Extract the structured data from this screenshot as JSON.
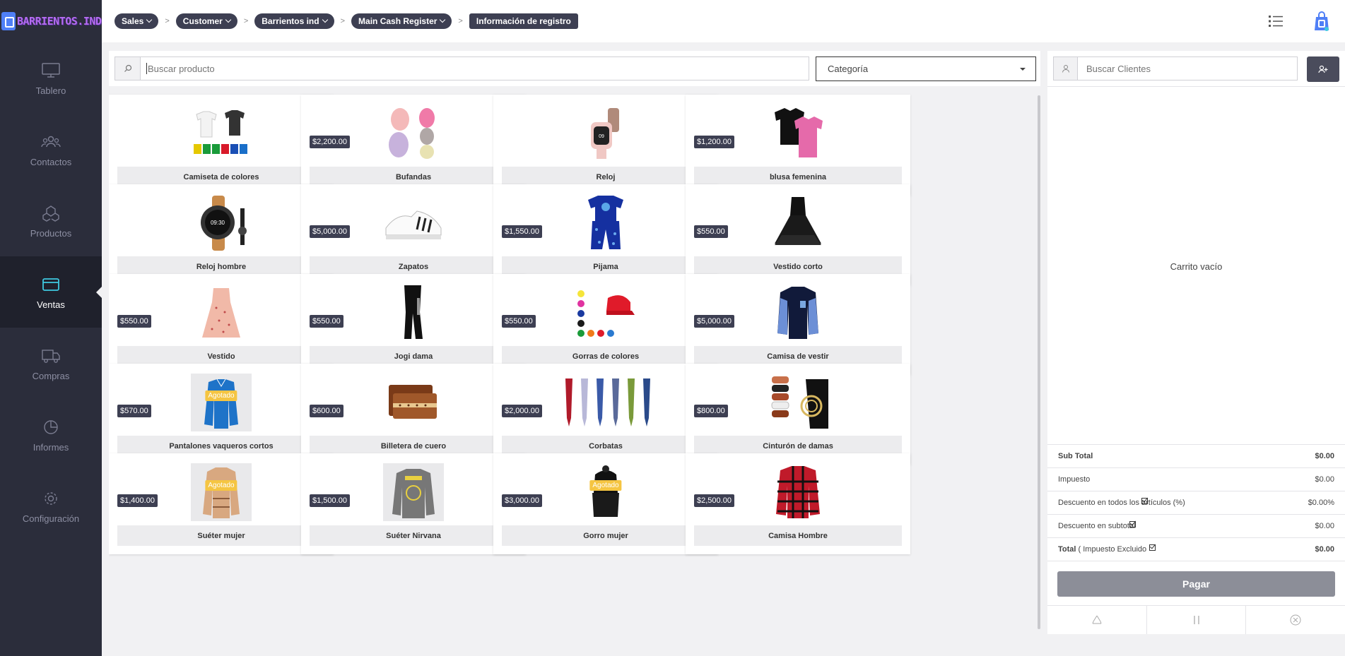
{
  "app": {
    "logo_text": "BARRIENTOS.IND"
  },
  "sidebar": {
    "items": [
      {
        "label": "Tablero",
        "icon": "monitor-icon",
        "active": false
      },
      {
        "label": "Contactos",
        "icon": "users-icon",
        "active": false
      },
      {
        "label": "Productos",
        "icon": "cubes-icon",
        "active": false
      },
      {
        "label": "Ventas",
        "icon": "card-icon",
        "active": true
      },
      {
        "label": "Compras",
        "icon": "truck-icon",
        "active": false
      },
      {
        "label": "Informes",
        "icon": "pie-chart-icon",
        "active": false
      },
      {
        "label": "Configuración",
        "icon": "gear-icon",
        "active": false
      }
    ]
  },
  "breadcrumb": {
    "items": [
      "Sales",
      "Customer",
      "Barrientos ind",
      "Main Cash Register"
    ],
    "last": "Información de registro",
    "separator": ">"
  },
  "search": {
    "placeholder": "Buscar producto"
  },
  "category": {
    "selected": "Categoría"
  },
  "products": [
    {
      "name": "Camiseta de colores",
      "price": "",
      "badge": ""
    },
    {
      "name": "Bufandas",
      "price": "$2,200.00",
      "badge": ""
    },
    {
      "name": "Reloj",
      "price": "",
      "badge": ""
    },
    {
      "name": "blusa femenina",
      "price": "$1,200.00",
      "badge": ""
    },
    {
      "name": "Reloj hombre",
      "price": "",
      "badge": ""
    },
    {
      "name": "Zapatos",
      "price": "$5,000.00",
      "badge": ""
    },
    {
      "name": "Pijama",
      "price": "$1,550.00",
      "badge": ""
    },
    {
      "name": "Vestido corto",
      "price": "$550.00",
      "badge": ""
    },
    {
      "name": "Vestido",
      "price": "$550.00",
      "badge": ""
    },
    {
      "name": "Jogi dama",
      "price": "$550.00",
      "badge": ""
    },
    {
      "name": "Gorras de colores",
      "price": "$550.00",
      "badge": ""
    },
    {
      "name": "Camisa de vestir",
      "price": "$5,000.00",
      "badge": ""
    },
    {
      "name": "Pantalones vaqueros cortos",
      "price": "$570.00",
      "badge": "Agotado"
    },
    {
      "name": "Billetera de cuero",
      "price": "$600.00",
      "badge": ""
    },
    {
      "name": "Corbatas",
      "price": "$2,000.00",
      "badge": ""
    },
    {
      "name": "Cinturón de damas",
      "price": "$800.00",
      "badge": ""
    },
    {
      "name": "Suéter mujer",
      "price": "$1,400.00",
      "badge": "Agotado"
    },
    {
      "name": "Suéter Nirvana",
      "price": "$1,500.00",
      "badge": ""
    },
    {
      "name": "Gorro mujer",
      "price": "$3,000.00",
      "badge": "Agotado"
    },
    {
      "name": "Camisa Hombre",
      "price": "$2,500.00",
      "badge": ""
    }
  ],
  "cart": {
    "customer_placeholder": "Buscar Clientes",
    "empty_text": "Carrito vacío",
    "subtotal_label": "Sub Total",
    "subtotal_value": "$0.00",
    "tax_label": "Impuesto",
    "tax_value": "$0.00",
    "discount_all_label": "Descuento en todos los artículos (%)",
    "discount_all_value": "$0.00%",
    "discount_sub_label": "Descuento en subtotal",
    "discount_sub_value": "$0.00",
    "total_label": "Total",
    "total_note": "( Impuesto Excluido",
    "total_value": "$0.00",
    "pay_label": "Pagar"
  },
  "colors": {
    "sidebar": "#2b2d3b",
    "accent": "#3d3f52",
    "active_icon": "#3fc9e0",
    "badge": "#f5c542"
  }
}
